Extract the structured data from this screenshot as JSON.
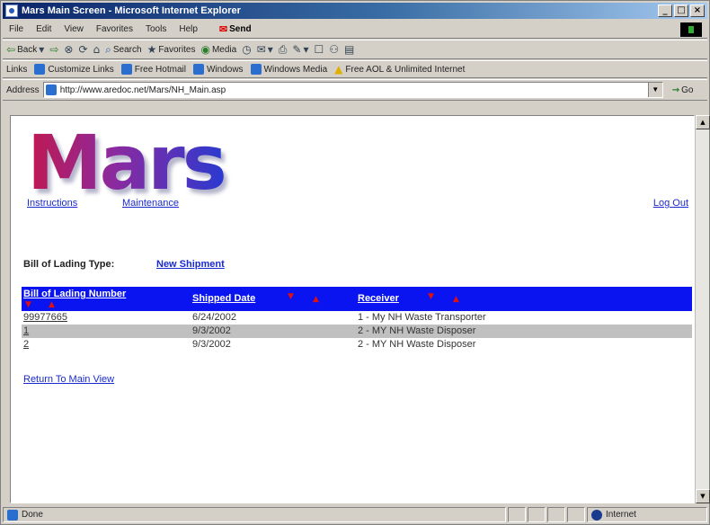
{
  "window": {
    "title": "Mars Main Screen - Microsoft Internet Explorer",
    "controls": {
      "minimize": "_",
      "maximize": "□",
      "close": "×"
    }
  },
  "menu": {
    "items": [
      "File",
      "Edit",
      "View",
      "Favorites",
      "Tools",
      "Help"
    ],
    "send_label": "Send"
  },
  "toolbar": {
    "back": "Back",
    "search": "Search",
    "favorites": "Favorites",
    "media": "Media"
  },
  "links": {
    "label": "Links",
    "items": [
      "Customize Links",
      "Free Hotmail",
      "Windows",
      "Windows Media",
      "Free AOL & Unlimited Internet"
    ]
  },
  "address": {
    "label": "Address",
    "url": "http://www.aredoc.net/Mars/NH_Main.asp",
    "go_label": "Go"
  },
  "page": {
    "logo_text": "Mars",
    "nav": {
      "instructions": "Instructions",
      "maintenance": "Maintenance",
      "logout": "Log Out"
    },
    "bol_type_label": "Bill of Lading Type:",
    "bol_type_value": "New Shipment",
    "table": {
      "headers": {
        "bol_number": "Bill of Lading Number",
        "shipped_date": "Shipped Date",
        "receiver": "Receiver"
      },
      "rows": [
        {
          "bol_number": "99977665",
          "shipped_date": "6/24/2002",
          "receiver": "1 - My NH Waste Transporter"
        },
        {
          "bol_number": "1",
          "shipped_date": "9/3/2002",
          "receiver": "2 - MY NH Waste Disposer"
        },
        {
          "bol_number": "2",
          "shipped_date": "9/3/2002",
          "receiver": "2 - MY NH Waste Disposer"
        }
      ]
    },
    "return_link": "Return To Main View"
  },
  "status": {
    "text": "Done",
    "zone": "Internet"
  },
  "colors": {
    "table_header_bg": "#0a14f0",
    "sort_arrow": "#e01010",
    "link": "#1a2ad0",
    "alt_row": "#c0c0c0"
  }
}
